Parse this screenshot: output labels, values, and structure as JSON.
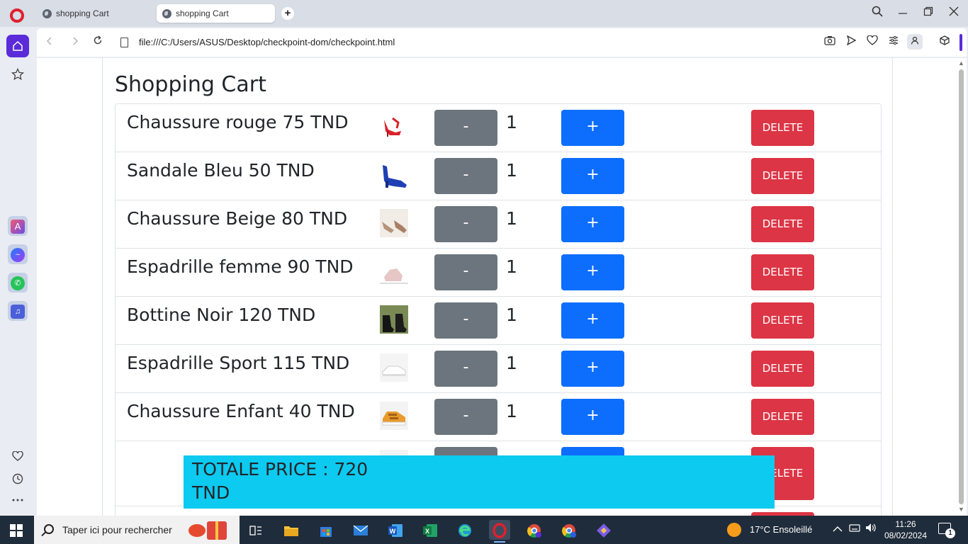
{
  "browser": {
    "tabs": [
      {
        "label": "shopping Cart",
        "active": false
      },
      {
        "label": "shopping Cart",
        "active": true
      }
    ],
    "new_tab_symbol": "+",
    "url": "file:///C:/Users/ASUS/Desktop/checkpoint-dom/checkpoint.html",
    "accent_color": "#5b2bd9"
  },
  "page": {
    "title": "Shopping Cart",
    "items": [
      {
        "name": "Chaussure rouge 75 TND",
        "qty": "1",
        "minus": "-",
        "plus": "+",
        "delete": "DELETE",
        "thumb_icon": "red-heel-shoe-icon"
      },
      {
        "name": "Sandale Bleu 50 TND",
        "qty": "1",
        "minus": "-",
        "plus": "+",
        "delete": "DELETE",
        "thumb_icon": "blue-sandal-icon"
      },
      {
        "name": "Chaussure Beige 80 TND",
        "qty": "1",
        "minus": "-",
        "plus": "+",
        "delete": "DELETE",
        "thumb_icon": "beige-shoe-icon"
      },
      {
        "name": "Espadrille femme 90 TND",
        "qty": "1",
        "minus": "-",
        "plus": "+",
        "delete": "DELETE",
        "thumb_icon": "pink-espadrille-icon"
      },
      {
        "name": "Bottine Noir 120 TND",
        "qty": "1",
        "minus": "-",
        "plus": "+",
        "delete": "DELETE",
        "thumb_icon": "black-boot-icon"
      },
      {
        "name": "Espadrille Sport 115 TND",
        "qty": "1",
        "minus": "-",
        "plus": "+",
        "delete": "DELETE",
        "thumb_icon": "white-sneaker-icon"
      },
      {
        "name": "Chaussure Enfant 40 TND",
        "qty": "1",
        "minus": "-",
        "plus": "+",
        "delete": "DELETE",
        "thumb_icon": "orange-kids-shoe-icon"
      },
      {
        "name": "",
        "qty": "",
        "minus": "",
        "plus": "",
        "delete": "DELETE",
        "thumb_icon": "partially-hidden-item"
      }
    ],
    "total_label": "TOTALE PRICE : 720 TND",
    "colors": {
      "minus_button": "#6c757d",
      "plus_button": "#0d6efd",
      "delete_button": "#dc3545",
      "total_background": "#0dcaf0"
    }
  },
  "taskbar": {
    "search_placeholder": "Taper ici pour rechercher",
    "weather": "17°C  Ensoleillé",
    "time": "11:26",
    "date": "08/02/2024",
    "notification_count": "1"
  }
}
